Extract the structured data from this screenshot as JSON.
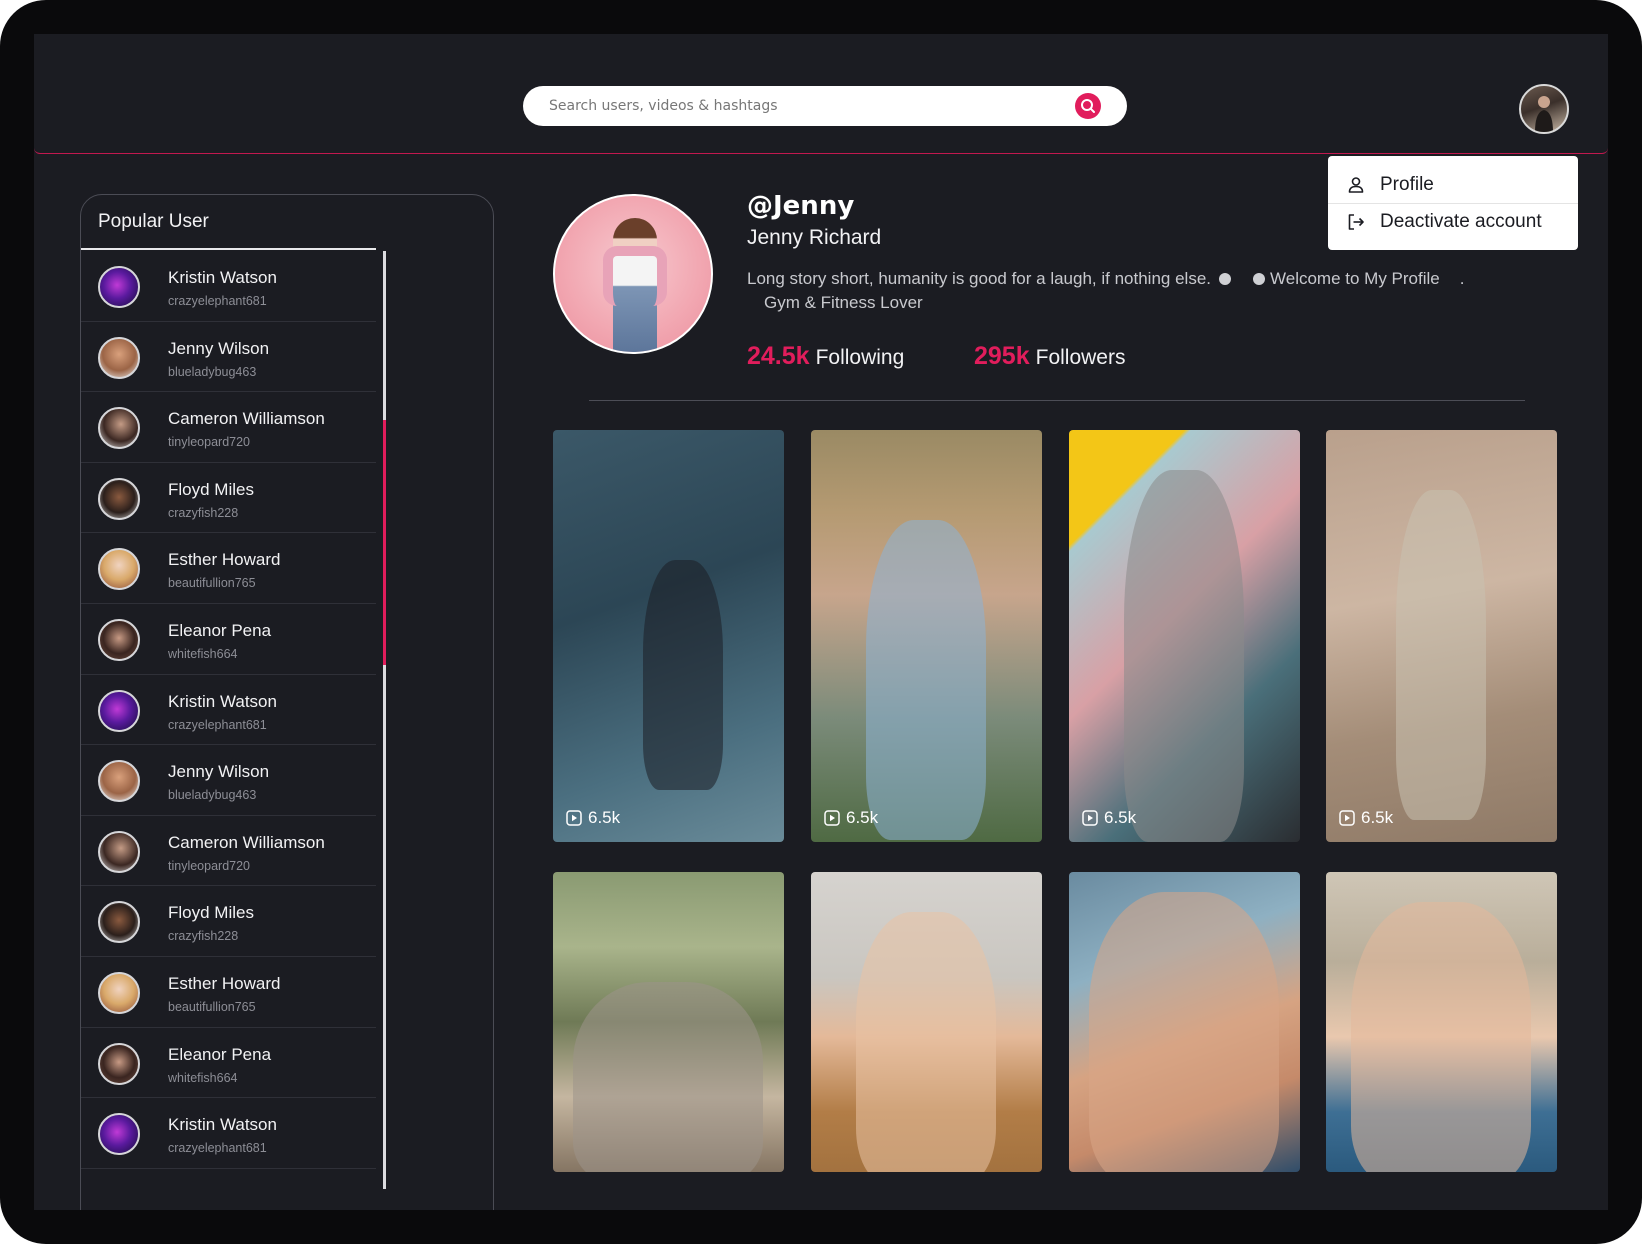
{
  "header": {
    "search_placeholder": "Search users, videos & hashtags",
    "search_icon": "search-icon",
    "avatar_icon": "user-avatar"
  },
  "dropdown": {
    "items": [
      {
        "label": "Profile",
        "icon": "user-icon"
      },
      {
        "label": "Deactivate account",
        "icon": "logout-icon"
      }
    ]
  },
  "sidebar": {
    "title": "Popular User",
    "users": [
      {
        "name": "Kristin Watson",
        "handle": "crazyelephant681"
      },
      {
        "name": "Jenny Wilson",
        "handle": "blueladybug463"
      },
      {
        "name": "Cameron Williamson",
        "handle": "tinyleopard720"
      },
      {
        "name": "Floyd Miles",
        "handle": "crazyfish228"
      },
      {
        "name": "Esther Howard",
        "handle": "beautifullion765"
      },
      {
        "name": "Eleanor Pena",
        "handle": "whitefish664"
      },
      {
        "name": "Kristin Watson",
        "handle": "crazyelephant681"
      },
      {
        "name": "Jenny Wilson",
        "handle": "blueladybug463"
      },
      {
        "name": "Cameron Williamson",
        "handle": "tinyleopard720"
      },
      {
        "name": "Floyd Miles",
        "handle": "crazyfish228"
      },
      {
        "name": "Esther Howard",
        "handle": "beautifullion765"
      },
      {
        "name": "Eleanor Pena",
        "handle": "whitefish664"
      },
      {
        "name": "Kristin Watson",
        "handle": "crazyelephant681"
      }
    ]
  },
  "profile": {
    "handle": "@Jenny",
    "name": "Jenny Richard",
    "bio_part1": "Long story short, humanity is good for a laugh, if nothing else.",
    "bio_part2": "Welcome to My Profile",
    "bio_part3": ".",
    "bio_line2": "Gym & Fitness Lover",
    "following_count": "24.5k",
    "following_label": "Following",
    "followers_count": "295k",
    "followers_label": "Followers"
  },
  "videos": [
    {
      "views": "6.5k"
    },
    {
      "views": "6.5k"
    },
    {
      "views": "6.5k"
    },
    {
      "views": "6.5k"
    },
    {
      "views": ""
    },
    {
      "views": ""
    },
    {
      "views": ""
    },
    {
      "views": ""
    }
  ],
  "colors": {
    "accent": "#e11d5c",
    "background": "#1b1c22"
  }
}
